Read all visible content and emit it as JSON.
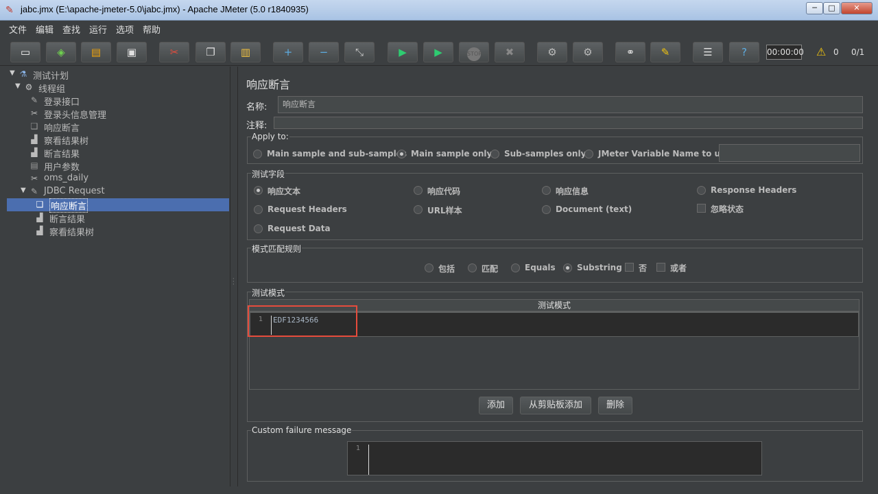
{
  "window": {
    "title": "jabc.jmx (E:\\apache-jmeter-5.0\\jabc.jmx) - Apache JMeter (5.0 r1840935)",
    "minimize": "─",
    "maximize": "□",
    "close": "✕"
  },
  "menu": [
    "文件",
    "编辑",
    "查找",
    "运行",
    "选项",
    "帮助"
  ],
  "toolbar": {
    "buttons": [
      {
        "name": "new-icon",
        "glyph": "▭"
      },
      {
        "name": "templates-icon",
        "glyph": "◈"
      },
      {
        "name": "open-icon",
        "glyph": "▤"
      },
      {
        "name": "save-icon",
        "glyph": "▣"
      },
      {
        "name": "cut-icon",
        "glyph": "✂"
      },
      {
        "name": "copy-icon",
        "glyph": "❐"
      },
      {
        "name": "paste-icon",
        "glyph": "▥"
      },
      {
        "name": "expand-icon",
        "glyph": "+"
      },
      {
        "name": "collapse-icon",
        "glyph": "−"
      },
      {
        "name": "toggle-icon",
        "glyph": "⤡"
      },
      {
        "name": "start-icon",
        "glyph": "▶"
      },
      {
        "name": "start-no-pause-icon",
        "glyph": "▶"
      },
      {
        "name": "stop-icon",
        "glyph": "STOP"
      },
      {
        "name": "shutdown-icon",
        "glyph": "✖"
      },
      {
        "name": "clear-icon",
        "glyph": "⚙"
      },
      {
        "name": "clear-all-icon",
        "glyph": "⚙"
      },
      {
        "name": "search-icon",
        "glyph": "⚭"
      },
      {
        "name": "reset-search-icon",
        "glyph": "✎"
      },
      {
        "name": "function-helper-icon",
        "glyph": "☰"
      },
      {
        "name": "help-icon",
        "glyph": "?"
      }
    ],
    "timer": "00:00:00",
    "warning_count": "0",
    "thread_count": "0/1"
  },
  "tree": [
    {
      "label": "测试计划",
      "icon": "flask-icon",
      "glyph": "⚗",
      "twisty": "▼",
      "indent": 0
    },
    {
      "label": "线程组",
      "icon": "gear-icon",
      "glyph": "⚙",
      "twisty": "▼",
      "indent": 1
    },
    {
      "label": "登录接口",
      "icon": "pen-icon",
      "glyph": "✎",
      "twisty": "",
      "indent": 2
    },
    {
      "label": "登录头信息管理",
      "icon": "tools-icon",
      "glyph": "✂",
      "twisty": "",
      "indent": 2
    },
    {
      "label": "响应断言",
      "icon": "assertion-icon",
      "glyph": "❑",
      "twisty": "",
      "indent": 2
    },
    {
      "label": "察看结果树",
      "icon": "chart-icon",
      "glyph": "▟",
      "twisty": "",
      "indent": 2
    },
    {
      "label": "断言结果",
      "icon": "chart-icon",
      "glyph": "▟",
      "twisty": "",
      "indent": 2
    },
    {
      "label": "用户参数",
      "icon": "document-icon",
      "glyph": "▤",
      "twisty": "",
      "indent": 2
    },
    {
      "label": "oms_daily",
      "icon": "tools-icon",
      "glyph": "✂",
      "twisty": "",
      "indent": 2
    },
    {
      "label": "JDBC Request",
      "icon": "pen-icon",
      "glyph": "✎",
      "twisty": "▼",
      "indent": 2
    },
    {
      "label": "响应断言",
      "icon": "assertion-icon",
      "glyph": "❑",
      "twisty": "",
      "indent": 3,
      "selected": true
    },
    {
      "label": "断言结果",
      "icon": "chart-icon",
      "glyph": "▟",
      "twisty": "",
      "indent": 3
    },
    {
      "label": "察看结果树",
      "icon": "chart-icon",
      "glyph": "▟",
      "twisty": "",
      "indent": 3
    }
  ],
  "panel": {
    "title": "响应断言",
    "name_label": "名称:",
    "name_value": "响应断言",
    "comment_label": "注释:",
    "apply_to": {
      "title": "Apply to:",
      "options": [
        "Main sample and sub-samples",
        "Main sample only",
        "Sub-samples only",
        "JMeter Variable Name to use"
      ],
      "selected": "Main sample only"
    },
    "test_field": {
      "title": "测试字段",
      "options": [
        "响应文本",
        "响应代码",
        "响应信息",
        "Response Headers",
        "Request Headers",
        "URL样本",
        "Document (text)",
        "Request Data"
      ],
      "selected": "响应文本",
      "ignore_status": "忽略状态"
    },
    "pattern_rules": {
      "title": "模式匹配规则",
      "options": [
        "包括",
        "匹配",
        "Equals",
        "Substring"
      ],
      "selected": "Substring",
      "not_label": "否",
      "or_label": "或者"
    },
    "patterns": {
      "title": "测试模式",
      "column": "测试模式",
      "line_no": "1",
      "value": "EDF1234566"
    },
    "buttons": {
      "add": "添加",
      "add_from_clipboard": "从剪贴板添加",
      "delete": "删除"
    },
    "failure": {
      "title": "Custom failure message",
      "line_no": "1"
    }
  }
}
